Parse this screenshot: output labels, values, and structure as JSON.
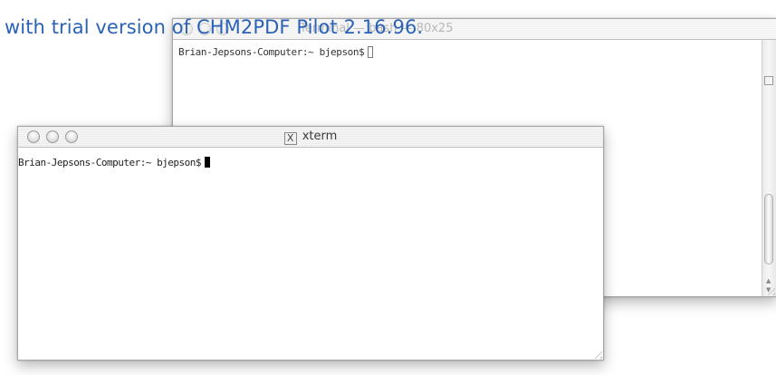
{
  "watermark": {
    "text": "with trial version of CHM2PDF Pilot 2.16.96."
  },
  "terminal_window": {
    "title": "Terminal — bash — 80x25",
    "prompt": "Brian-Jepsons-Computer:~ bjepson$"
  },
  "xterm_window": {
    "title": "xterm",
    "title_icon": "x-window-icon",
    "prompt": "Brian-Jepsons-Computer:~ bjepson$"
  },
  "colors": {
    "watermark": "#2a62b8",
    "cursor": "#000000"
  }
}
